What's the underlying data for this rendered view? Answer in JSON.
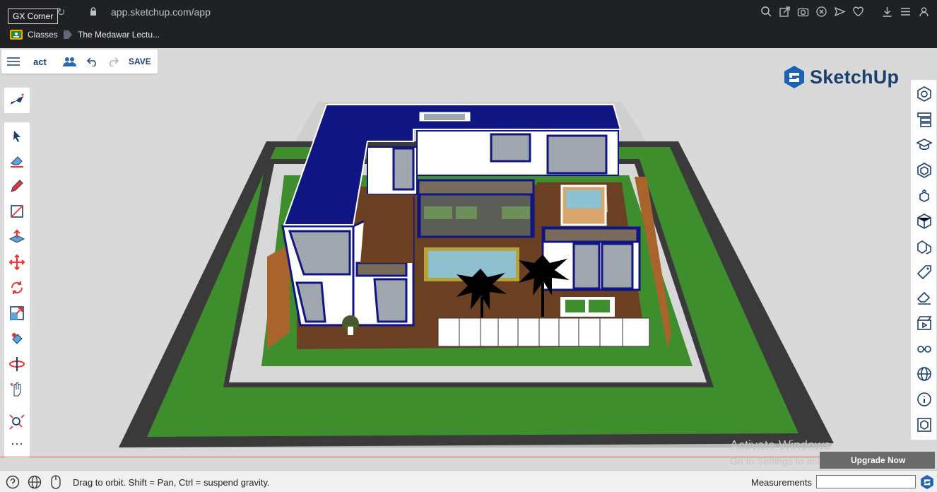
{
  "browser": {
    "tooltip": "GX Corner",
    "url": "app.sketchup.com/app",
    "bookmarks": [
      {
        "label": "Classes"
      },
      {
        "label": "The Medawar Lectu..."
      }
    ]
  },
  "app": {
    "document_title": "act",
    "save_label": "SAVE",
    "brand": "SketchUp"
  },
  "status": {
    "hint": "Drag to orbit. Shift = Pan, Ctrl = suspend gravity.",
    "measurements_label": "Measurements",
    "measurements_value": ""
  },
  "overlay": {
    "activate_title": "Activate Windows",
    "activate_sub": "Go to Settings to activate Windows.",
    "upgrade": "Upgrade Now"
  },
  "colors": {
    "accent": "#1b3f6e",
    "roof": "#0f1683",
    "grass": "#3c8b2b",
    "deck": "#6b3f22",
    "pool": "#7fb6c8"
  }
}
